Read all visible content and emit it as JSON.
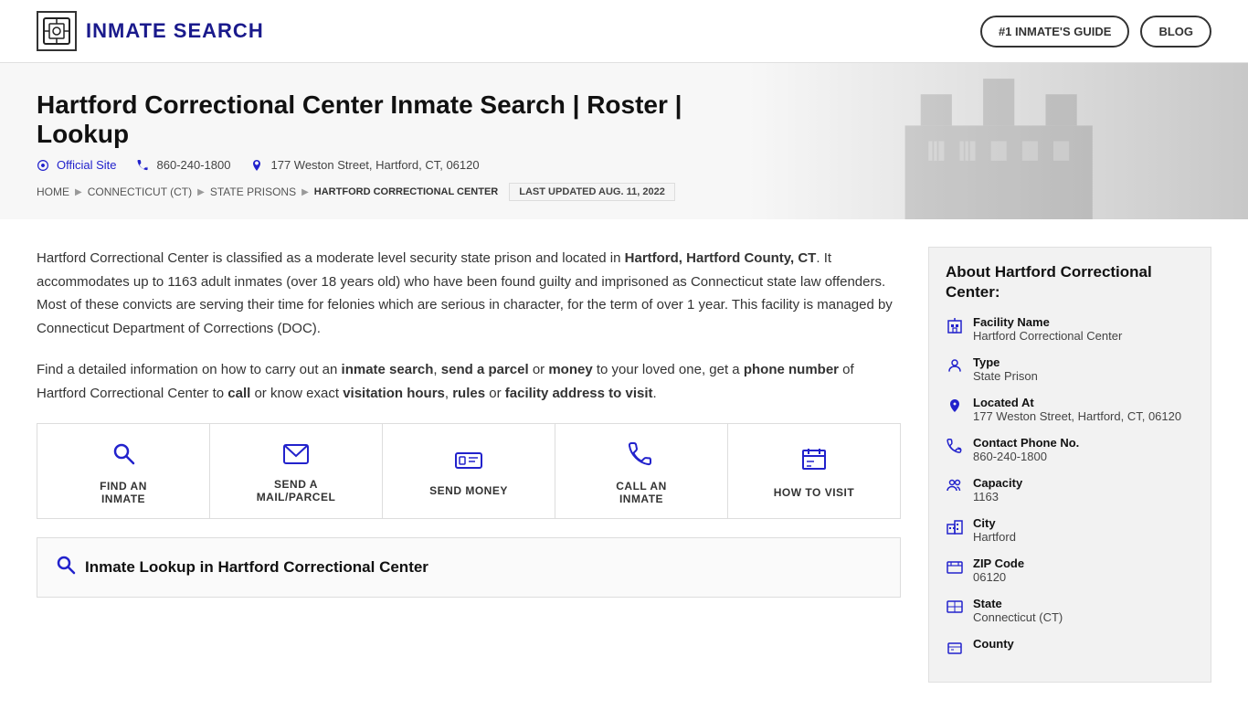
{
  "header": {
    "logo_text": "INMATE SEARCH",
    "logo_icon": "🏛",
    "nav_buttons": [
      {
        "label": "#1 INMATE'S GUIDE",
        "id": "inmates-guide"
      },
      {
        "label": "BLOG",
        "id": "blog"
      }
    ]
  },
  "hero": {
    "title": "Hartford Correctional Center Inmate Search | Roster | Lookup",
    "meta": {
      "official_site_label": "Official Site",
      "phone": "860-240-1800",
      "address": "177 Weston Street, Hartford, CT, 06120"
    },
    "breadcrumb": [
      {
        "label": "HOME",
        "href": "#"
      },
      {
        "label": "CONNECTICUT (CT)",
        "href": "#"
      },
      {
        "label": "STATE PRISONS",
        "href": "#"
      },
      {
        "label": "HARTFORD CORRECTIONAL CENTER",
        "href": "#"
      }
    ],
    "last_updated": "LAST UPDATED AUG. 11, 2022"
  },
  "body": {
    "paragraph1": "Hartford Correctional Center is classified as a moderate level security state prison and located in Hartford, Hartford County, CT. It accommodates up to 1163 adult inmates (over 18 years old) who have been found guilty and imprisoned as Connecticut state law offenders. Most of these convicts are serving their time for felonies which are serious in character, for the term of over 1 year. This facility is managed by Connecticut Department of Corrections (DOC).",
    "paragraph1_bold": [
      "Hartford, Hartford County, CT"
    ],
    "paragraph2_prefix": "Find a detailed information on how to carry out an ",
    "paragraph2_bold1": "inmate search",
    "paragraph2_mid1": ", ",
    "paragraph2_bold2": "send a parcel",
    "paragraph2_mid2": " or ",
    "paragraph2_bold3": "money",
    "paragraph2_mid3": " to your loved one, get a ",
    "paragraph2_bold4": "phone number",
    "paragraph2_mid4": " of Hartford Correctional Center to ",
    "paragraph2_bold5": "call",
    "paragraph2_mid5": " or know exact ",
    "paragraph2_bold6": "visitation hours",
    "paragraph2_mid6": ", ",
    "paragraph2_bold7": "rules",
    "paragraph2_mid7": " or ",
    "paragraph2_bold8": "facility address to visit",
    "paragraph2_suffix": "."
  },
  "action_cards": [
    {
      "icon": "🔍",
      "label": "FIND AN\nINMATE",
      "id": "find-an-inmate"
    },
    {
      "icon": "✉",
      "label": "SEND A\nMAIL/PARCEL",
      "id": "send-mail"
    },
    {
      "icon": "💳",
      "label": "SEND MONEY",
      "id": "send-money"
    },
    {
      "icon": "📞",
      "label": "CALL AN\nINMATE",
      "id": "call-an-inmate"
    },
    {
      "icon": "📋",
      "label": "HOW TO VISIT",
      "id": "how-to-visit"
    }
  ],
  "lookup_section": {
    "heading": "Inmate Lookup in Hartford Correctional Center"
  },
  "sidebar": {
    "heading": "About Hartford Correctional Center:",
    "rows": [
      {
        "icon": "🏢",
        "label": "Facility Name",
        "value": "Hartford Correctional Center",
        "id": "facility-name"
      },
      {
        "icon": "👤",
        "label": "Type",
        "value": "State Prison",
        "id": "type"
      },
      {
        "icon": "📍",
        "label": "Located At",
        "value": "177 Weston Street, Hartford, CT, 06120",
        "id": "located-at"
      },
      {
        "icon": "📞",
        "label": "Contact Phone No.",
        "value": "860-240-1800",
        "id": "contact-phone"
      },
      {
        "icon": "👥",
        "label": "Capacity",
        "value": "1163",
        "id": "capacity"
      },
      {
        "icon": "🏙",
        "label": "City",
        "value": "Hartford",
        "id": "city"
      },
      {
        "icon": "✉",
        "label": "ZIP Code",
        "value": "06120",
        "id": "zip-code"
      },
      {
        "icon": "🗺",
        "label": "State",
        "value": "Connecticut (CT)",
        "id": "state"
      },
      {
        "icon": "🏛",
        "label": "County",
        "value": "",
        "id": "county"
      }
    ]
  }
}
